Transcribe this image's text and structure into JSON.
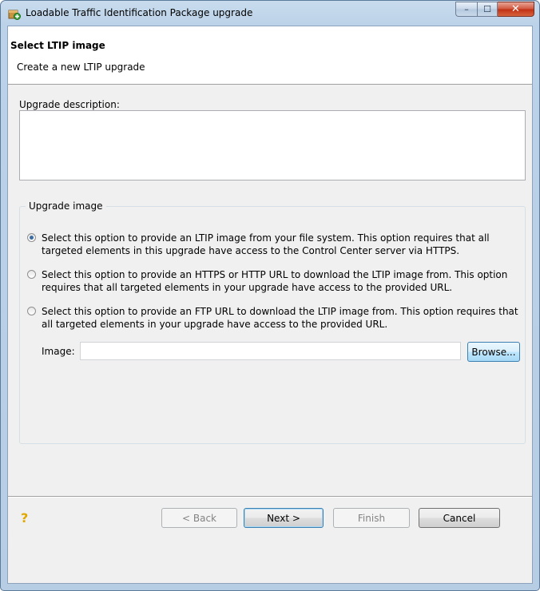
{
  "window": {
    "title": "Loadable Traffic Identification Package upgrade",
    "icon": "package-upgrade-icon",
    "minimize_glyph": "–",
    "maximize_glyph": "☐",
    "close_glyph": "✕"
  },
  "header": {
    "title": "Select LTIP image",
    "subtitle": "Create a new LTIP upgrade"
  },
  "description": {
    "label": "Upgrade description:",
    "value": ""
  },
  "upgrade_image": {
    "group_label": "Upgrade image",
    "options": [
      {
        "text": "Select this option to provide an LTIP image from your file system. This option requires that all targeted elements in this upgrade have access to the Control Center server via HTTPS.",
        "selected": true
      },
      {
        "text": "Select this option to provide an HTTPS or HTTP URL to download the LTIP image from. This option requires that all targeted elements in your upgrade have access to the provided URL.",
        "selected": false
      },
      {
        "text": "Select this option to provide an FTP URL to download the LTIP image from. This option requires that all targeted elements in your upgrade have access to the provided URL.",
        "selected": false
      }
    ],
    "image_label": "Image:",
    "image_value": "",
    "browse_label": "Browse..."
  },
  "footer": {
    "help_icon": "help-icon",
    "help_glyph": "?",
    "back_label": "< Back",
    "next_label": "Next >",
    "finish_label": "Finish",
    "cancel_label": "Cancel"
  },
  "colors": {
    "accent": "#3c7fb1",
    "radio_selected": "#3d6ca3",
    "close_button": "#c02f12"
  }
}
